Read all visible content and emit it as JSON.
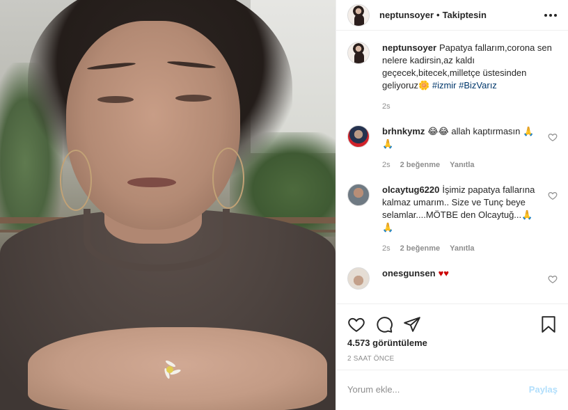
{
  "post": {
    "username": "neptunsoyer",
    "separator": "•",
    "follow_status": "Takiptesin",
    "caption": {
      "username": "neptunsoyer",
      "text": "Papatya fallarım,corona sen nelere kadirsin,az kaldı geçecek,bitecek,milletçe üstesinden geliyoruz",
      "emoji": "🌼",
      "hashtags": [
        "#izmir",
        "#BizVarız"
      ],
      "time": "2s"
    },
    "comments": [
      {
        "username": "brhnkymz",
        "text": "😂😂 allah kaptırmasın 🙏🙏",
        "time": "2s",
        "likes": "2 beğenme",
        "reply": "Yanıtla"
      },
      {
        "username": "olcaytug6220",
        "text": "İşimiz papatya fallarına kalmaz umarım.. Size ve Tunç beye selamlar....MÖTBE den Olcaytuğ...🙏🙏",
        "time": "2s",
        "likes": "2 beğenme",
        "reply": "Yanıtla"
      },
      {
        "username": "onesgunsen",
        "text": "♥♥",
        "time": "",
        "likes": "",
        "reply": ""
      }
    ],
    "views": "4.573 görüntüleme",
    "posted_ago": "2 SAAT ÖNCE",
    "comment_input": {
      "placeholder": "Yorum ekle..."
    },
    "post_button": "Paylaş",
    "icons": [
      "heart-icon",
      "comment-icon",
      "share-icon",
      "save-icon",
      "more-icon"
    ],
    "colors": {
      "link": "#00376b",
      "post_disabled": "#b2dffc",
      "muted": "#8e8e8e"
    }
  }
}
